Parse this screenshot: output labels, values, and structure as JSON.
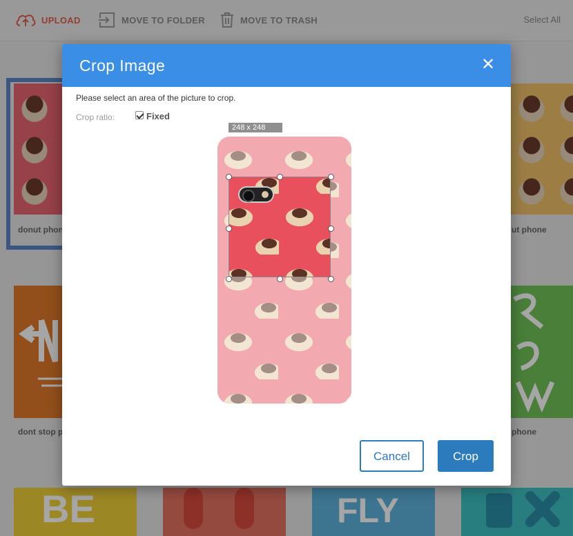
{
  "toolbar": {
    "upload_label": "UPLOAD",
    "move_label": "MOVE TO FOLDER",
    "trash_label": "MOVE TO TRASH",
    "select_all_label": "Select All",
    "upload_color": "#e0604c"
  },
  "gallery": {
    "tiles": [
      {
        "label": "donut phone"
      },
      {
        "label": "ut phone"
      },
      {
        "label": "dont stop p"
      },
      {
        "label": "phone"
      }
    ]
  },
  "modal": {
    "title": "Crop Image",
    "close_icon": "close-icon",
    "instructions": "Please select an area of the picture to crop.",
    "crop_ratio_label": "Crop ratio:",
    "fixed_label": "Fixed",
    "fixed_checked": true,
    "selection_size": "248 x 248",
    "cancel_label": "Cancel",
    "crop_label": "Crop",
    "header_color": "#3a8ee6",
    "button_color": "#2b7bbd"
  }
}
